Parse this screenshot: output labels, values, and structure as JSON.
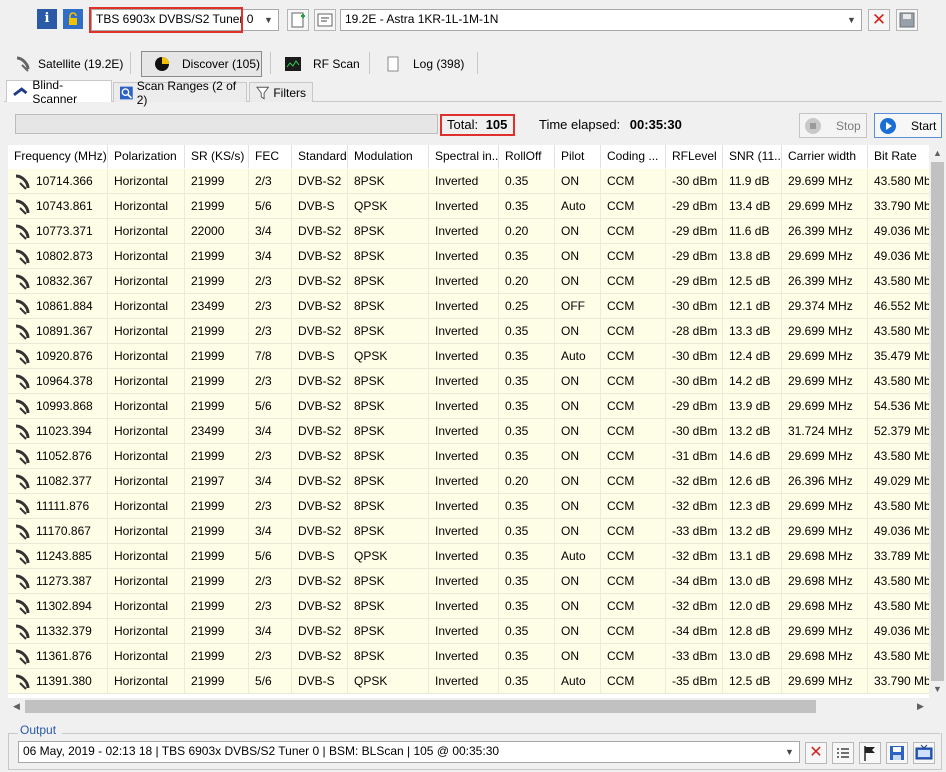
{
  "toolbar": {
    "tuner": "TBS 6903x DVBS/S2 Tuner 0",
    "satellite": "19.2E - Astra 1KR-1L-1M-1N"
  },
  "modes": {
    "satellite": "Satellite (19.2E)",
    "discover": "Discover (105)",
    "rfscan": "RF Scan",
    "log": "Log (398)"
  },
  "subtabs": {
    "blind": "Blind-Scanner",
    "ranges": "Scan Ranges (2 of 2)",
    "filters": "Filters"
  },
  "scan": {
    "total_label": "Total:",
    "total": "105",
    "elapsed_label": "Time elapsed:",
    "elapsed": "00:35:30",
    "stop": "Stop",
    "start": "Start"
  },
  "table": {
    "columns": [
      "Frequency (MHz)",
      "Polarization",
      "SR (KS/s)",
      "FEC",
      "Standard",
      "Modulation",
      "Spectral in...",
      "RollOff",
      "Pilot",
      "Coding ...",
      "RFLevel",
      "SNR (11...",
      "Carrier width",
      "Bit Rate"
    ],
    "rows": [
      [
        "10714.366",
        "Horizontal",
        "21999",
        "2/3",
        "DVB-S2",
        "8PSK",
        "Inverted",
        "0.35",
        "ON",
        "CCM",
        "-30 dBm",
        "11.9 dB",
        "29.699 MHz",
        "43.580 Mb"
      ],
      [
        "10743.861",
        "Horizontal",
        "21999",
        "5/6",
        "DVB-S",
        "QPSK",
        "Inverted",
        "0.35",
        "Auto",
        "CCM",
        "-29 dBm",
        "13.4 dB",
        "29.699 MHz",
        "33.790 Mb"
      ],
      [
        "10773.371",
        "Horizontal",
        "22000",
        "3/4",
        "DVB-S2",
        "8PSK",
        "Inverted",
        "0.20",
        "ON",
        "CCM",
        "-29 dBm",
        "11.6 dB",
        "26.399 MHz",
        "49.036 Mb"
      ],
      [
        "10802.873",
        "Horizontal",
        "21999",
        "3/4",
        "DVB-S2",
        "8PSK",
        "Inverted",
        "0.35",
        "ON",
        "CCM",
        "-29 dBm",
        "13.8 dB",
        "29.699 MHz",
        "49.036 Mb"
      ],
      [
        "10832.367",
        "Horizontal",
        "21999",
        "2/3",
        "DVB-S2",
        "8PSK",
        "Inverted",
        "0.20",
        "ON",
        "CCM",
        "-29 dBm",
        "12.5 dB",
        "26.399 MHz",
        "43.580 Mb"
      ],
      [
        "10861.884",
        "Horizontal",
        "23499",
        "2/3",
        "DVB-S2",
        "8PSK",
        "Inverted",
        "0.25",
        "OFF",
        "CCM",
        "-30 dBm",
        "12.1 dB",
        "29.374 MHz",
        "46.552 Mb"
      ],
      [
        "10891.367",
        "Horizontal",
        "21999",
        "2/3",
        "DVB-S2",
        "8PSK",
        "Inverted",
        "0.35",
        "ON",
        "CCM",
        "-28 dBm",
        "13.3 dB",
        "29.699 MHz",
        "43.580 Mb"
      ],
      [
        "10920.876",
        "Horizontal",
        "21999",
        "7/8",
        "DVB-S",
        "QPSK",
        "Inverted",
        "0.35",
        "Auto",
        "CCM",
        "-30 dBm",
        "12.4 dB",
        "29.699 MHz",
        "35.479 Mb"
      ],
      [
        "10964.378",
        "Horizontal",
        "21999",
        "2/3",
        "DVB-S2",
        "8PSK",
        "Inverted",
        "0.35",
        "ON",
        "CCM",
        "-30 dBm",
        "14.2 dB",
        "29.699 MHz",
        "43.580 Mb"
      ],
      [
        "10993.868",
        "Horizontal",
        "21999",
        "5/6",
        "DVB-S2",
        "8PSK",
        "Inverted",
        "0.35",
        "ON",
        "CCM",
        "-29 dBm",
        "13.9 dB",
        "29.699 MHz",
        "54.536 Mb"
      ],
      [
        "11023.394",
        "Horizontal",
        "23499",
        "3/4",
        "DVB-S2",
        "8PSK",
        "Inverted",
        "0.35",
        "ON",
        "CCM",
        "-30 dBm",
        "13.2 dB",
        "31.724 MHz",
        "52.379 Mb"
      ],
      [
        "11052.876",
        "Horizontal",
        "21999",
        "2/3",
        "DVB-S2",
        "8PSK",
        "Inverted",
        "0.35",
        "ON",
        "CCM",
        "-31 dBm",
        "14.6 dB",
        "29.699 MHz",
        "43.580 Mb"
      ],
      [
        "11082.377",
        "Horizontal",
        "21997",
        "3/4",
        "DVB-S2",
        "8PSK",
        "Inverted",
        "0.20",
        "ON",
        "CCM",
        "-32 dBm",
        "12.6 dB",
        "26.396 MHz",
        "49.029 Mb"
      ],
      [
        "11111.876",
        "Horizontal",
        "21999",
        "2/3",
        "DVB-S2",
        "8PSK",
        "Inverted",
        "0.35",
        "ON",
        "CCM",
        "-32 dBm",
        "12.3 dB",
        "29.699 MHz",
        "43.580 Mb"
      ],
      [
        "11170.867",
        "Horizontal",
        "21999",
        "3/4",
        "DVB-S2",
        "8PSK",
        "Inverted",
        "0.35",
        "ON",
        "CCM",
        "-33 dBm",
        "13.2 dB",
        "29.699 MHz",
        "49.036 Mb"
      ],
      [
        "11243.885",
        "Horizontal",
        "21999",
        "5/6",
        "DVB-S",
        "QPSK",
        "Inverted",
        "0.35",
        "Auto",
        "CCM",
        "-32 dBm",
        "13.1 dB",
        "29.698 MHz",
        "33.789 Mb"
      ],
      [
        "11273.387",
        "Horizontal",
        "21999",
        "2/3",
        "DVB-S2",
        "8PSK",
        "Inverted",
        "0.35",
        "ON",
        "CCM",
        "-34 dBm",
        "13.0 dB",
        "29.698 MHz",
        "43.580 Mb"
      ],
      [
        "11302.894",
        "Horizontal",
        "21999",
        "2/3",
        "DVB-S2",
        "8PSK",
        "Inverted",
        "0.35",
        "ON",
        "CCM",
        "-32 dBm",
        "12.0 dB",
        "29.698 MHz",
        "43.580 Mb"
      ],
      [
        "11332.379",
        "Horizontal",
        "21999",
        "3/4",
        "DVB-S2",
        "8PSK",
        "Inverted",
        "0.35",
        "ON",
        "CCM",
        "-34 dBm",
        "12.8 dB",
        "29.699 MHz",
        "49.036 Mb"
      ],
      [
        "11361.876",
        "Horizontal",
        "21999",
        "2/3",
        "DVB-S2",
        "8PSK",
        "Inverted",
        "0.35",
        "ON",
        "CCM",
        "-33 dBm",
        "13.0 dB",
        "29.698 MHz",
        "43.580 Mb"
      ],
      [
        "11391.380",
        "Horizontal",
        "21999",
        "5/6",
        "DVB-S",
        "QPSK",
        "Inverted",
        "0.35",
        "Auto",
        "CCM",
        "-35 dBm",
        "12.5 dB",
        "29.699 MHz",
        "33.790 Mb"
      ]
    ]
  },
  "output": {
    "label": "Output",
    "text": "06 May, 2019 - 02:13 18 | TBS 6903x DVBS/S2 Tuner 0 | BSM: BLScan | 105 @ 00:35:30"
  },
  "icons": {
    "info": "info-icon",
    "lock": "lock-icon",
    "new": "new-document-icon",
    "edit": "edit-icon",
    "close": "close-icon",
    "save": "save-icon",
    "dish": "satellite-dish-icon"
  },
  "colors": {
    "row_bg": "#fefee6",
    "highlight_box": "#e0302b",
    "start_icon": "#1a6fd6"
  }
}
